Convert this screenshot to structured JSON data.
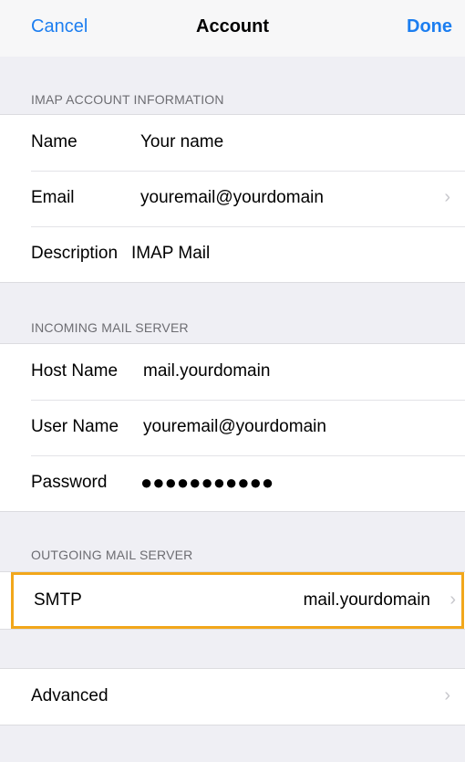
{
  "nav": {
    "cancel": "Cancel",
    "title": "Account",
    "done": "Done"
  },
  "account_section": {
    "header": "IMAP ACCOUNT INFORMATION",
    "rows": [
      {
        "label": "Name",
        "value": "Your name"
      },
      {
        "label": "Email",
        "value": "youremail@yourdomain",
        "chevron": "›"
      },
      {
        "label": "Description",
        "value": "IMAP Mail"
      }
    ]
  },
  "incoming_section": {
    "header": "INCOMING MAIL SERVER",
    "rows": [
      {
        "label": "Host Name",
        "value": "mail.yourdomain"
      },
      {
        "label": "User Name",
        "value": "youremail@yourdomain"
      },
      {
        "label": "Password",
        "value": "●●●●●●●●●●●"
      }
    ]
  },
  "outgoing_section": {
    "header": "OUTGOING MAIL SERVER",
    "smtp": {
      "label": "SMTP",
      "value": "mail.yourdomain",
      "chevron": "›"
    },
    "highlight_color": "#f2a71b"
  },
  "advanced": {
    "label": "Advanced",
    "chevron": "›"
  },
  "colors": {
    "accent": "#1c7ef0",
    "background": "#efeff4"
  }
}
